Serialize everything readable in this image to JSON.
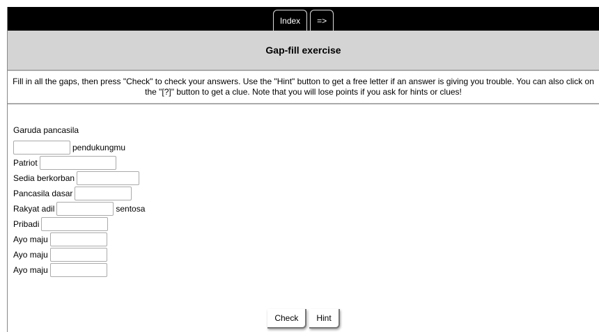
{
  "nav": {
    "index_label": "Index",
    "next_label": "=>"
  },
  "title": "Gap-fill exercise",
  "instructions": "Fill in all the gaps, then press \"Check\" to check your answers. Use the \"Hint\" button to get a free letter if an answer is giving you trouble. You can also click on the \"[?]\" button to get a clue. Note that you will lose points if you ask for hints or clues!",
  "lines": {
    "l0": "Garuda pancasila",
    "l1_after": "pendukungmu",
    "l2": "Patriot",
    "l3": "Sedia berkorban",
    "l4": "Pancasila dasar",
    "l5_before": "Rakyat adil",
    "l5_after": "sentosa",
    "l6": "Pribadi",
    "l7": "Ayo maju",
    "l8": "Ayo maju",
    "l9": "Ayo maju"
  },
  "gaps": [
    "",
    "",
    "",
    "",
    "",
    "",
    "",
    "",
    ""
  ],
  "buttons": {
    "check": "Check",
    "hint": "Hint"
  },
  "colors": {
    "navbar": "#000000",
    "titlebar": "#d4d4d4",
    "background": "#ffffff"
  }
}
